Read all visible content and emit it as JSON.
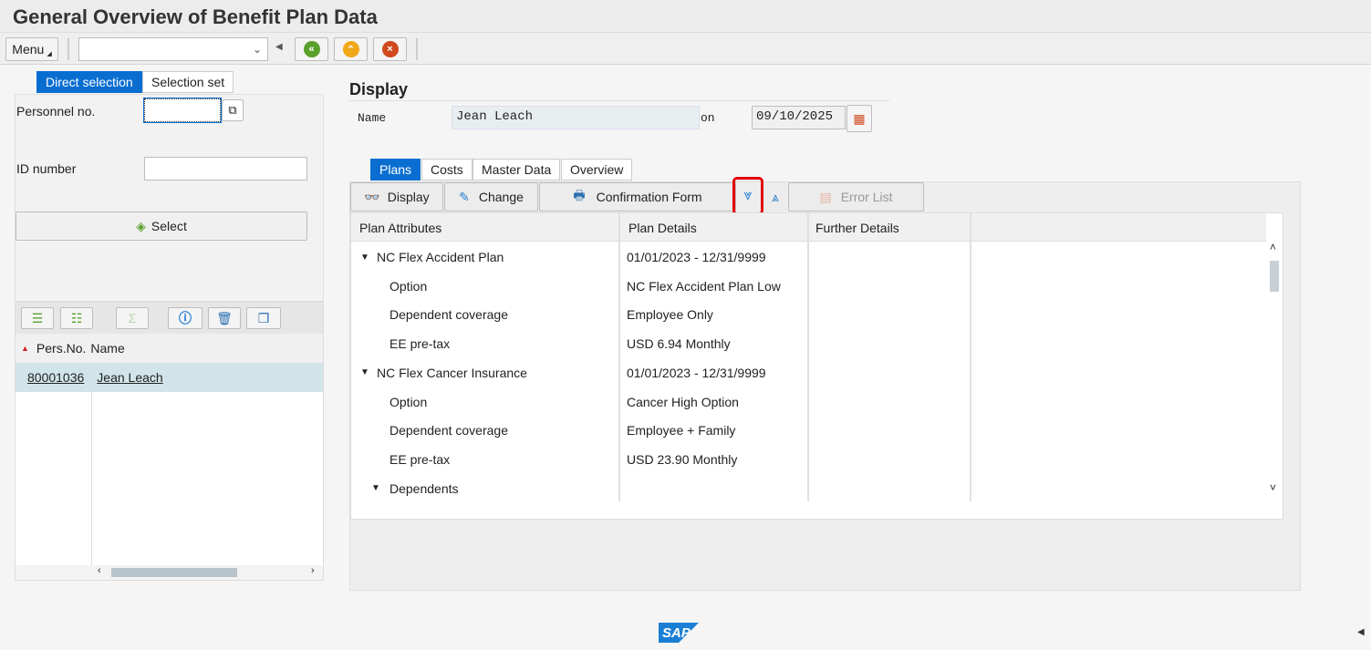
{
  "window": {
    "title": "General Overview of Benefit Plan Data"
  },
  "toolbar": {
    "menu_label": "Menu",
    "command_value": "",
    "icons": [
      "back-icon",
      "exit-icon",
      "cancel-icon"
    ]
  },
  "left": {
    "tabs": [
      {
        "label": "Direct selection",
        "active": true
      },
      {
        "label": "Selection set",
        "active": false
      }
    ],
    "personnel_label": "Personnel no.",
    "personnel_value": "",
    "id_label": "ID number",
    "id_value": "",
    "select_label": "Select",
    "list_headers": [
      "Pers.No.",
      "Name"
    ],
    "list_rows": [
      {
        "pers_no": "80001036",
        "name": "Jean Leach"
      }
    ]
  },
  "main": {
    "section_title": "Display",
    "name_label": "Name",
    "name_value": "Jean Leach",
    "on_label": "on",
    "date_value": "09/10/2025",
    "tabs": [
      {
        "label": "Plans",
        "active": true
      },
      {
        "label": "Costs"
      },
      {
        "label": "Master Data"
      },
      {
        "label": "Overview"
      }
    ],
    "actions": {
      "display": "Display",
      "change": "Change",
      "confirmation": "Confirmation Form",
      "error_list": "Error List"
    },
    "columns": [
      "Plan Attributes",
      "Plan Details",
      "Further Details"
    ],
    "rows": [
      {
        "attr": "NC Flex Accident Plan",
        "detail": "01/01/2023 - 12/31/9999",
        "level": 0,
        "expanded": true
      },
      {
        "attr": "Option",
        "detail": "NC Flex Accident Plan Low",
        "level": 1
      },
      {
        "attr": "Dependent coverage",
        "detail": "Employee Only",
        "level": 1
      },
      {
        "attr": "EE pre-tax",
        "detail": "USD 6.94 Monthly",
        "level": 1
      },
      {
        "attr": "NC Flex Cancer Insurance",
        "detail": "01/01/2023 - 12/31/9999",
        "level": 0,
        "expanded": true
      },
      {
        "attr": "Option",
        "detail": "Cancer High Option",
        "level": 1
      },
      {
        "attr": "Dependent coverage",
        "detail": "Employee + Family",
        "level": 1
      },
      {
        "attr": "EE pre-tax",
        "detail": "USD 23.90 Monthly",
        "level": 1
      },
      {
        "attr": "Dependents",
        "detail": "",
        "level": 1,
        "expanded": true
      }
    ]
  },
  "footer": {
    "logo": "SAP"
  },
  "colors": {
    "accent": "#0a6ed1",
    "highlight": "#d1e4ea",
    "callout": "#e00000"
  }
}
